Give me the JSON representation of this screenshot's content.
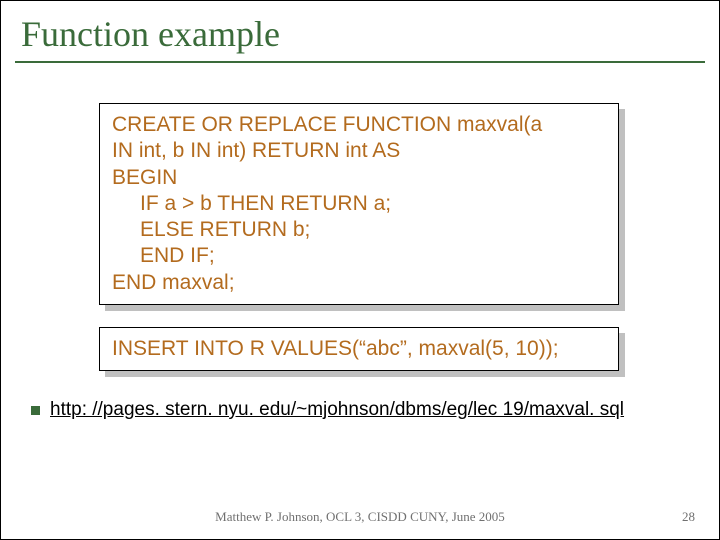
{
  "title": "Function example",
  "code": {
    "l1": "CREATE OR REPLACE FUNCTION maxval(a",
    "l2": "IN int, b IN int) RETURN int AS",
    "l3": "BEGIN",
    "l4": "IF a > b THEN RETURN a;",
    "l5": "ELSE RETURN b;",
    "l6": "END IF;",
    "l7": "END maxval;"
  },
  "insert_stmt": "INSERT INTO R VALUES(“abc”, maxval(5, 10));",
  "link_text": "http: //pages. stern. nyu. edu/~mjohnson/dbms/eg/lec 19/maxval. sql",
  "footer": "Matthew P. Johnson, OCL 3, CISDD CUNY, June 2005",
  "page_number": "28"
}
